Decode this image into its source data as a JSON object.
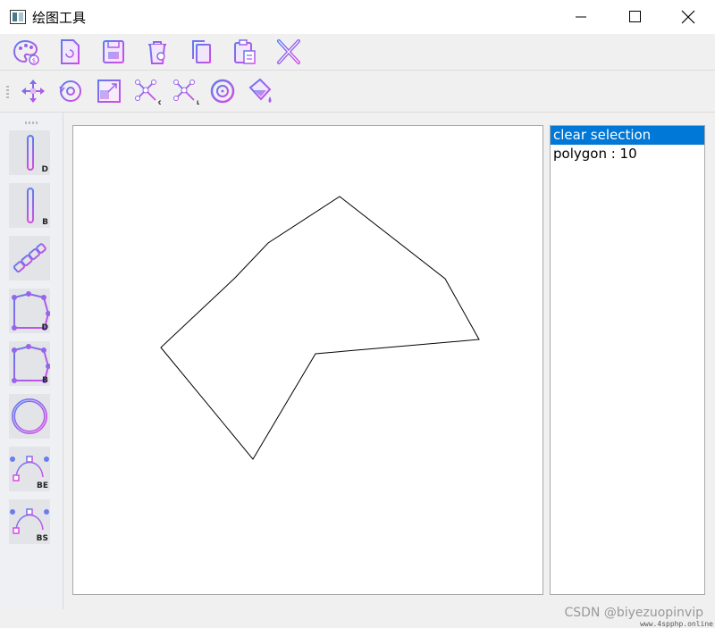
{
  "window": {
    "title": "绘图工具"
  },
  "toolbar1": {
    "items": [
      "palette-icon",
      "new-file-icon",
      "save-icon",
      "clear-icon",
      "copy-icon",
      "paste-icon",
      "delete-icon"
    ]
  },
  "toolbar2": {
    "items": [
      "move-icon",
      "rotate-icon",
      "scale-icon",
      "clip-cohen-sutherland-icon",
      "clip-liang-barsky-icon",
      "circle-select-icon",
      "fill-bucket-icon"
    ]
  },
  "tools": {
    "line_dda_label": "D",
    "line_bresenham_label": "B",
    "polygon_dda_label": "D",
    "polygon_bresenham_label": "B",
    "curve_bezier_label": "BE",
    "curve_bspline_label": "BS"
  },
  "list": {
    "items": [
      "clear selection",
      "polygon : 10"
    ],
    "selected_index": 0
  },
  "colors": {
    "accent": "#0078d7",
    "icon_gradient_start": "#5c7cf0",
    "icon_gradient_end": "#d44ce6"
  },
  "watermark": "CSDN @biyezuopinvip",
  "watermark_small": "www.4spphp.online"
}
